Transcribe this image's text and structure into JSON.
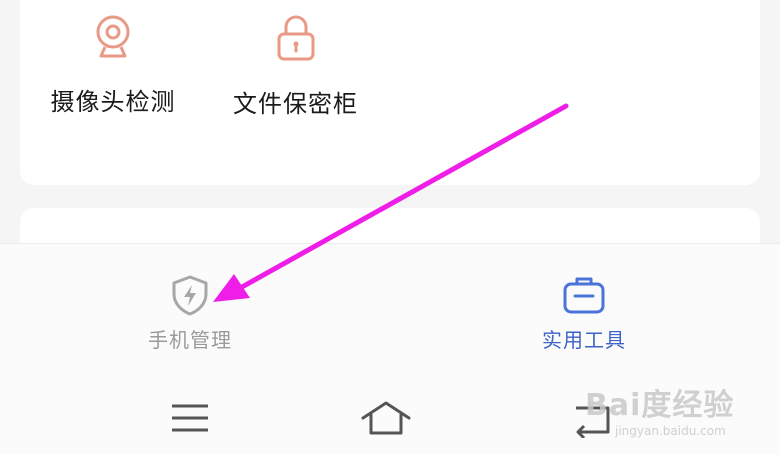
{
  "tools": [
    {
      "label": "摄像头检测",
      "icon": "webcam-icon"
    },
    {
      "label": "文件保密柜",
      "icon": "padlock-icon"
    }
  ],
  "bottom_nav": {
    "tabs": [
      {
        "label": "手机管理",
        "icon": "shield-lightning-icon",
        "active": false
      },
      {
        "label": "实用工具",
        "icon": "toolbox-icon",
        "active": true
      }
    ]
  },
  "system_nav": {
    "buttons": [
      "menu-icon",
      "home-icon",
      "back-icon"
    ]
  },
  "watermark": {
    "text": "Bai度经验",
    "url": "jingyan.baidu.com"
  },
  "colors": {
    "tool_icon": "#e89a86",
    "inactive_tab": "#9a9a9a",
    "active_tab": "#3c63c6",
    "arrow": "#ee1ee8"
  }
}
